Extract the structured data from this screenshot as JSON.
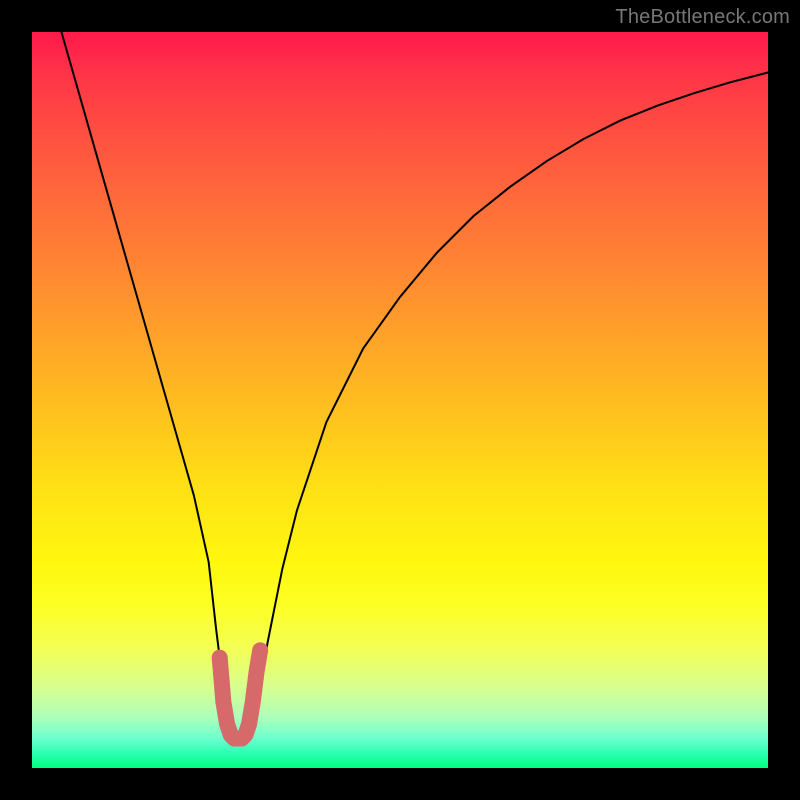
{
  "watermark": "TheBottleneck.com",
  "chart_data": {
    "type": "line",
    "title": "",
    "xlabel": "",
    "ylabel": "",
    "xlim": [
      0,
      100
    ],
    "ylim": [
      0,
      100
    ],
    "grid": false,
    "legend": false,
    "series": [
      {
        "name": "bottleneck-curve",
        "color": "#000000",
        "x": [
          4,
          6,
          8,
          10,
          12,
          14,
          16,
          18,
          20,
          22,
          24,
          25,
          26,
          27,
          28,
          29,
          30,
          31,
          32,
          34,
          36,
          40,
          45,
          50,
          55,
          60,
          65,
          70,
          75,
          80,
          85,
          90,
          95,
          100
        ],
        "y": [
          100,
          93,
          86,
          79,
          72,
          65,
          58,
          51,
          44,
          37,
          28,
          19,
          11,
          6,
          4,
          4,
          6,
          11,
          17,
          27,
          35,
          47,
          57,
          64,
          70,
          75,
          79,
          82.5,
          85.5,
          88,
          90,
          91.7,
          93.2,
          94.5
        ]
      },
      {
        "name": "optimal-marker",
        "color": "#d66a6a",
        "x": [
          25.5,
          26,
          26.5,
          27,
          27.5,
          28,
          28.5,
          29,
          29.5,
          30,
          30.5,
          31
        ],
        "y": [
          15,
          9,
          6,
          4.5,
          4,
          4,
          4,
          4.5,
          6,
          9,
          13,
          16
        ]
      }
    ],
    "background_gradient": {
      "top": "#ff1a4b",
      "middle": "#ffe314",
      "bottom": "#00ff7f"
    }
  }
}
